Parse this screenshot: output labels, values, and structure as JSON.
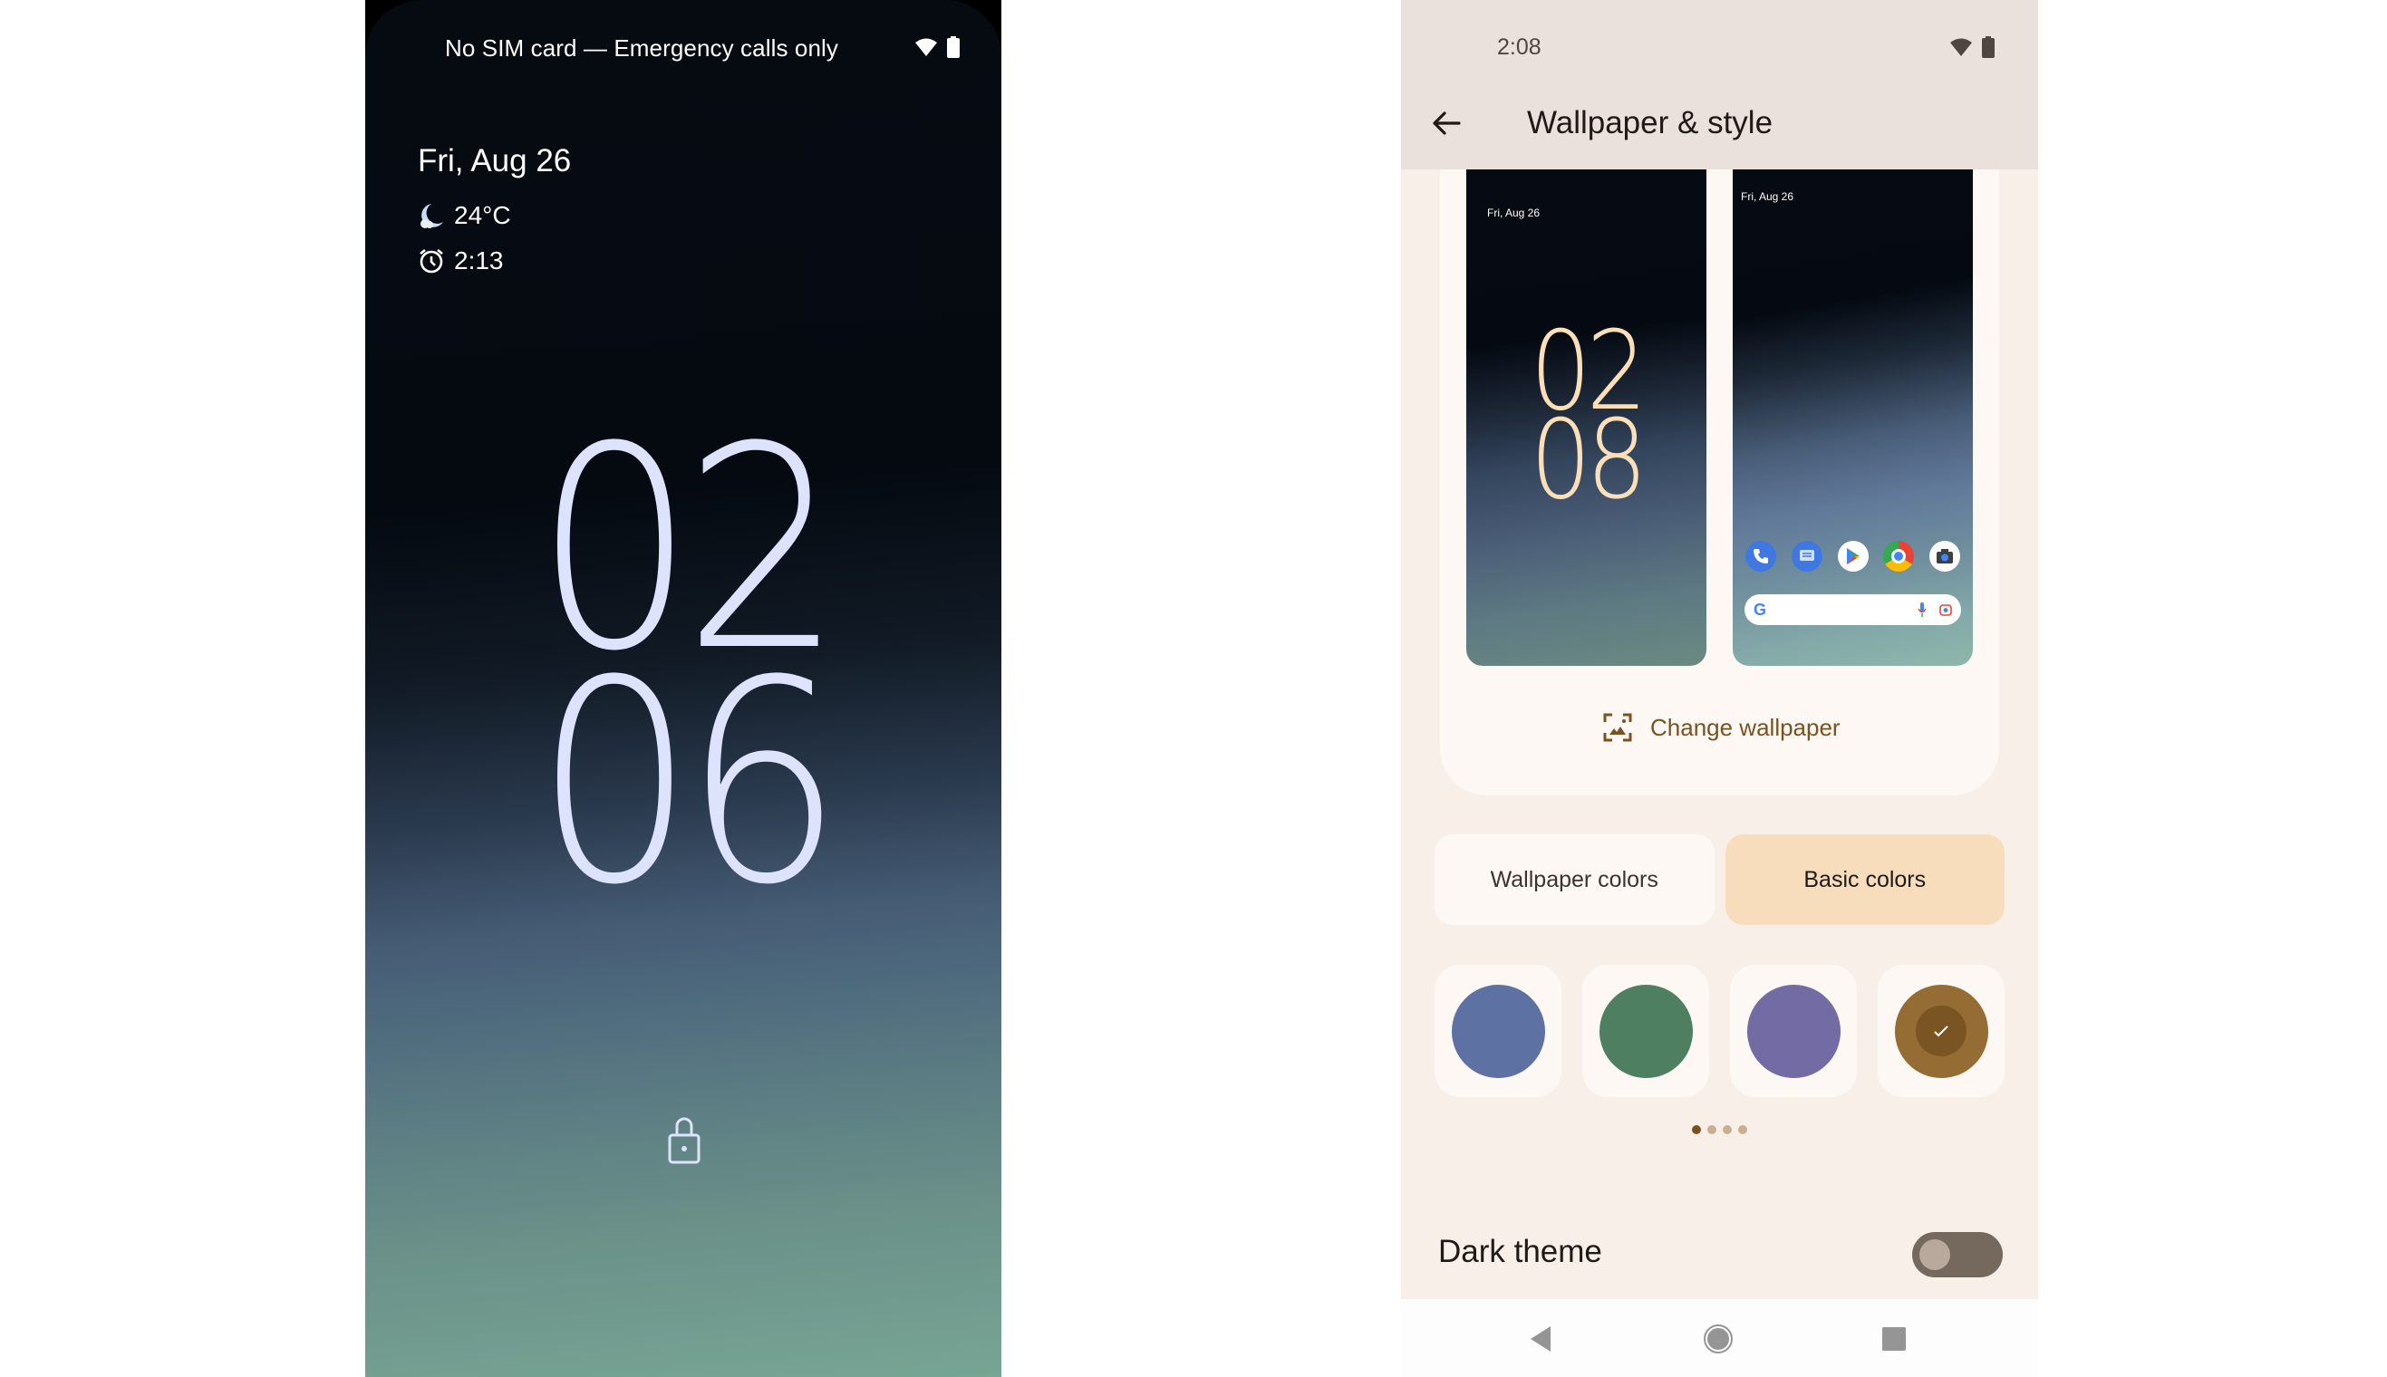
{
  "lock_screen": {
    "status_bar": {
      "carrier_text": "No SIM card — Emergency calls only",
      "icons": [
        "wifi-icon",
        "battery-icon"
      ]
    },
    "date": "Fri, Aug 26",
    "weather": {
      "icon": "moon-cloud-icon",
      "temperature": "24°C"
    },
    "alarm": {
      "icon": "alarm-clock-icon",
      "time": "2:13"
    },
    "clock": {
      "hours": "02",
      "minutes": "06"
    },
    "lock_icon": "lock-icon",
    "colors": {
      "clock": "#dde3fd"
    }
  },
  "wallpaper_style": {
    "status_bar": {
      "time": "2:08",
      "icons": [
        "wifi-icon",
        "battery-icon"
      ]
    },
    "header": {
      "back_icon": "arrow-left-icon",
      "title": "Wallpaper & style"
    },
    "previews": {
      "lock": {
        "date": "Fri, Aug 26",
        "clock_hours": "02",
        "clock_minutes": "08"
      },
      "home": {
        "date": "Fri, Aug 26",
        "dock_apps": [
          "Phone",
          "Messages",
          "Play Store",
          "Chrome",
          "Camera"
        ],
        "search_bar": {
          "logo": "G",
          "icons": [
            "mic-icon",
            "lens-icon"
          ]
        }
      }
    },
    "change_wallpaper_label": "Change wallpaper",
    "color_tabs": [
      {
        "label": "Wallpaper colors",
        "selected": false
      },
      {
        "label": "Basic colors",
        "selected": true
      }
    ],
    "swatches": [
      {
        "name": "blue",
        "color": "#5e71a3",
        "selected": false
      },
      {
        "name": "green",
        "color": "#4e7f61",
        "selected": false
      },
      {
        "name": "purple",
        "color": "#736ba3",
        "selected": false
      },
      {
        "name": "brown",
        "color": "#966c35",
        "inner_color": "#7a5422",
        "selected": true
      }
    ],
    "pagination": {
      "pages": 4,
      "current": 1
    },
    "dark_theme": {
      "label": "Dark theme",
      "enabled": false
    },
    "nav_bar": [
      "back",
      "home",
      "recents"
    ],
    "colors": {
      "header_bg": "#ebe1dc",
      "page_bg": "#f8efe9",
      "card_bg": "#fdf8f4",
      "accent": "#7a5220",
      "selected_tab_bg": "#f8ddbc",
      "mini_clock": "#fbdfb8"
    }
  }
}
